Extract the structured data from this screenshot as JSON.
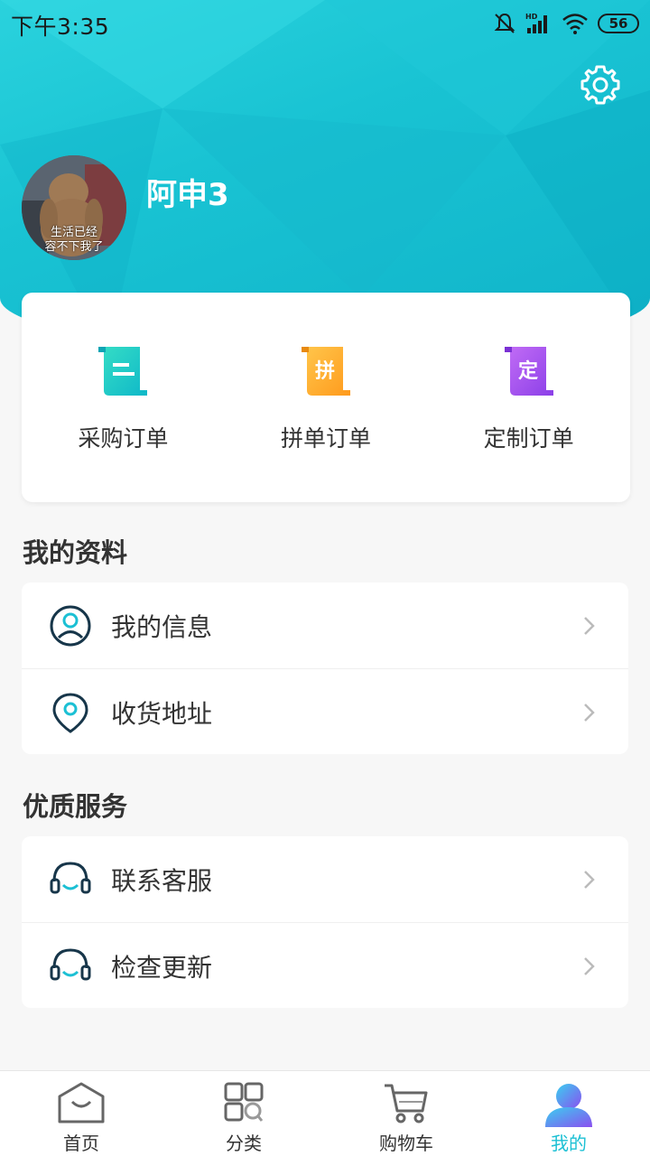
{
  "status_bar": {
    "time": "下午3:35",
    "battery": "56",
    "network_label": "HD"
  },
  "profile": {
    "username": "阿申3",
    "avatar_caption_line1": "生活已经",
    "avatar_caption_line2": "容不下我了"
  },
  "orders": [
    {
      "label": "采购订单",
      "icon": "purchase-order-icon",
      "glyph": "",
      "color": "#17c8c8"
    },
    {
      "label": "拼单订单",
      "icon": "group-order-icon",
      "glyph": "拼",
      "color": "#ffab2e"
    },
    {
      "label": "定制订单",
      "icon": "custom-order-icon",
      "glyph": "定",
      "color": "#a64ff0"
    }
  ],
  "sections": {
    "profile_title": "我的资料",
    "profile_items": [
      {
        "label": "我的信息",
        "icon": "user-icon"
      },
      {
        "label": "收货地址",
        "icon": "location-pin-icon"
      }
    ],
    "service_title": "优质服务",
    "service_items": [
      {
        "label": "联系客服",
        "icon": "headset-icon"
      },
      {
        "label": "检查更新",
        "icon": "headset-icon"
      }
    ]
  },
  "nav": [
    {
      "label": "首页",
      "icon": "home-icon",
      "active": false
    },
    {
      "label": "分类",
      "icon": "category-icon",
      "active": false
    },
    {
      "label": "购物车",
      "icon": "cart-icon",
      "active": false
    },
    {
      "label": "我的",
      "icon": "profile-icon",
      "active": true
    }
  ],
  "colors": {
    "accent": "#1cc0d4",
    "header_start": "#2ad2dd",
    "header_end": "#10b3c9"
  }
}
